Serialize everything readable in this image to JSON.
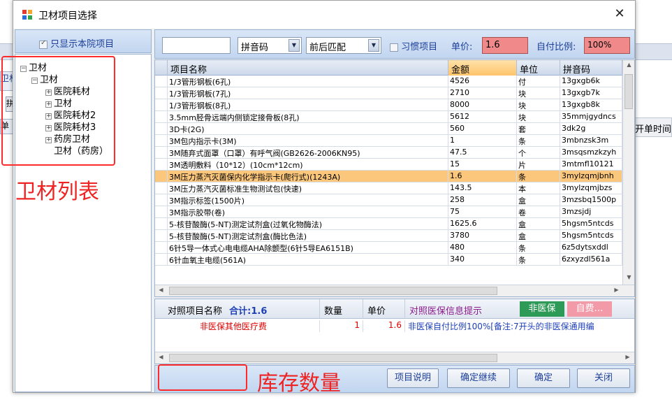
{
  "window": {
    "title": "卫材项目选择"
  },
  "background": {
    "tab_text": "卫材列表",
    "button_text": "拼",
    "header_text": "单",
    "right_column": "开单时间"
  },
  "left": {
    "only_this_hospital_label": "只显示本院项目",
    "tree": [
      {
        "label": "卫材",
        "prefix": "−"
      },
      {
        "label": "卫材",
        "prefix": "−"
      },
      {
        "label": "医院耗材",
        "prefix": "+"
      },
      {
        "label": "卫材",
        "prefix": "+"
      },
      {
        "label": "医院耗材2",
        "prefix": "+"
      },
      {
        "label": "医院耗材3",
        "prefix": "+"
      },
      {
        "label": "药房卫材",
        "prefix": "+"
      },
      {
        "label": "卫材（药房）",
        "prefix": ""
      }
    ]
  },
  "annotations": {
    "material_list": "卫材列表",
    "stock_quantity": "库存数量"
  },
  "toolbar": {
    "search_value": "",
    "search_mode": "拼音码",
    "match_mode": "前后匹配",
    "habit_label": "习惯项目",
    "price_label": "单价:",
    "price_value": "1.6",
    "self_pay_label": "自付比例:",
    "self_pay_value": "100%"
  },
  "grid": {
    "columns": [
      "项目名称",
      "金额",
      "单位",
      "拼音码"
    ],
    "rows": [
      [
        "1/3管形钢板(6孔)",
        "4526",
        "付",
        "13gxgb6k"
      ],
      [
        "1/3管形钢板(7孔)",
        "2710",
        "块",
        "13gxgb7k"
      ],
      [
        "1/3管形钢板(8孔)",
        "8000",
        "块",
        "13gxgb8k"
      ],
      [
        "3.5mm胫骨远端内侧锁定接骨板(8孔)",
        "5612",
        "块",
        "35mmjgydncs"
      ],
      [
        "3D卡(2G)",
        "560",
        "套",
        "3dk2g"
      ],
      [
        "3M包内指示卡(3M)",
        "1",
        "条",
        "3mbnzsk3m"
      ],
      [
        "3M随弃式面罩（口罩）有呼气阀(GB2626-2006KN95)",
        "47.5",
        "个",
        "3msqsmzkzyh"
      ],
      [
        "3M透明敷料（10*12）(10cm*12cm)",
        "15",
        "片",
        "3mtmfl10121"
      ],
      [
        "3M压力蒸汽灭菌保内化学指示卡(爬行式)(1243A)",
        "1.6",
        "条",
        "3mylzqmjbnh"
      ],
      [
        "3M压力蒸汽灭菌标准生物测试包(快速)",
        "143.5",
        "本",
        "3mylzqmjbzs"
      ],
      [
        "3M指示标签(1500片)",
        "258",
        "盒",
        "3mzsbq1500p"
      ],
      [
        "3M指示胶带(卷)",
        "75",
        "卷",
        "3mzsjdj"
      ],
      [
        "5-核苷酸酶(5-NT)测定试剂盒(过氧化物酶法)",
        "1625.6",
        "盒",
        "5hgsm5ntcds"
      ],
      [
        "5-核苷酸酶(5-NT)测定试剂盒(酶比色法)",
        "3780",
        "盒",
        "5hgsm5ntcds"
      ],
      [
        "6针5导一体式心电电缆AHA除颤型(6针5导EA6151B)",
        "480",
        "条",
        "6z5dytsxddl"
      ],
      [
        "6针血氧主电缆(561A)",
        "340",
        "条",
        "6zxyzdl561a"
      ]
    ],
    "selected_row": 8
  },
  "lower": {
    "columns": {
      "name": "对照项目名称",
      "total": "合计:1.6",
      "qty": "数量",
      "price": "单价",
      "hint": "对照医保信息提示"
    },
    "badge_green": "非医保",
    "badge_pink": "自费…",
    "row": {
      "name": "非医保其他医疗费",
      "qty": "1",
      "price": "1.6",
      "hint": "非医保自付比例100%[备注:7开头的非医保通用编"
    }
  },
  "buttons": {
    "item_desc": "项目说明",
    "confirm_continue": "确定继续",
    "confirm": "确定",
    "close": "关闭"
  },
  "colors": {
    "selected_row": "#fbc77c",
    "sorted_header": "#fdc46b",
    "price_field": "#f08a8a",
    "badge_green": "#2e9a57",
    "badge_pink": "#f29aa8",
    "annotation_red": "#ee2424"
  }
}
